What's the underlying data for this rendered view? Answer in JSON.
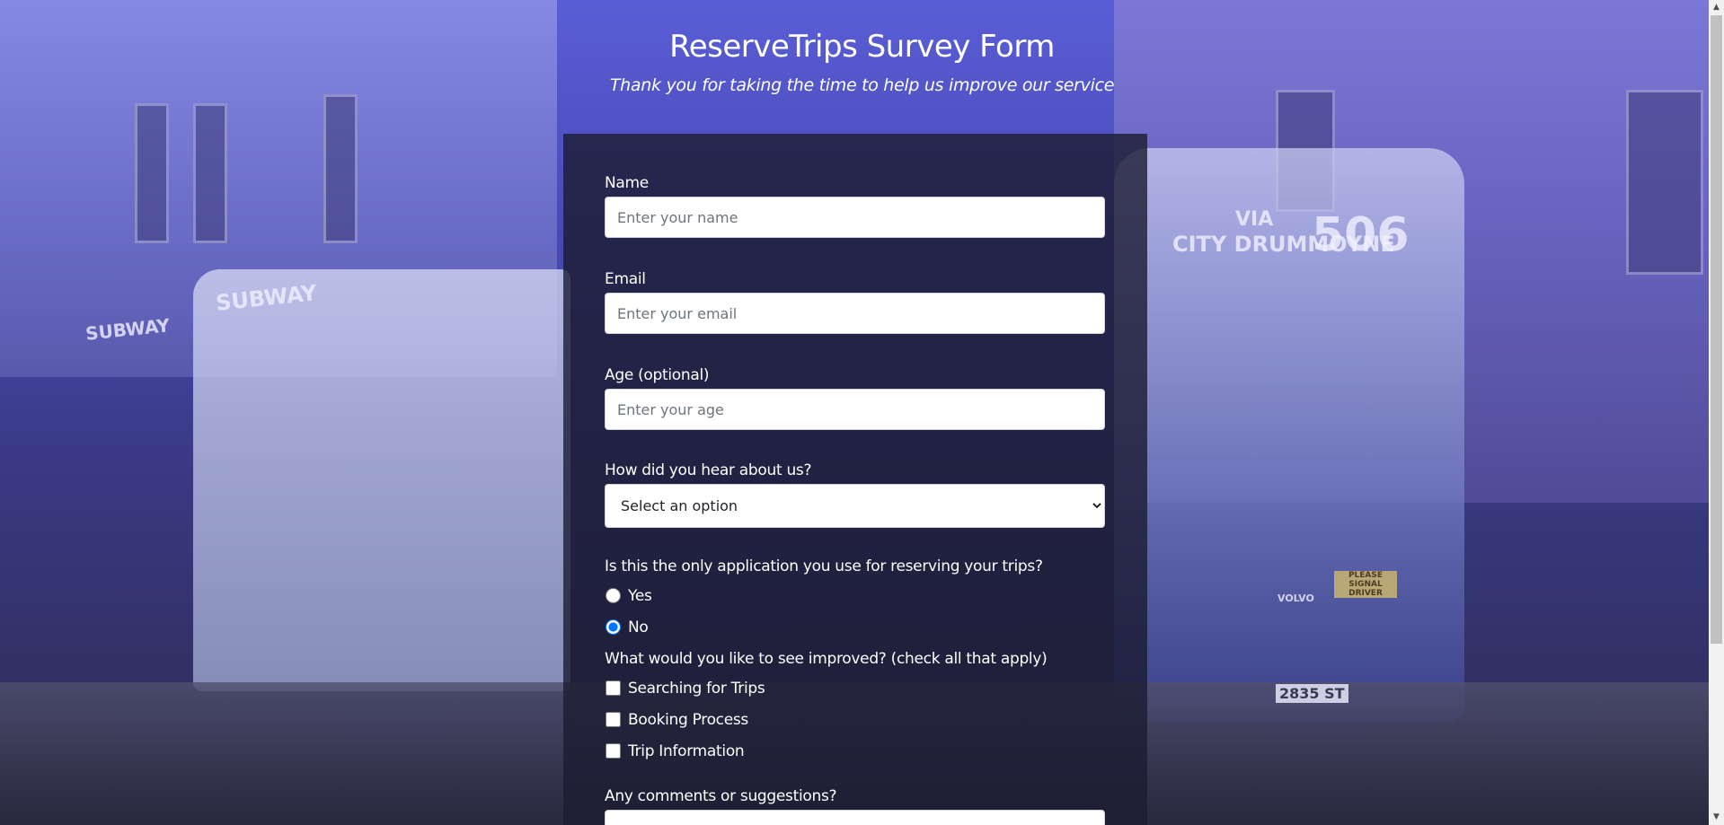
{
  "header": {
    "title": "ReserveTrips Survey Form",
    "subtitle": "Thank you for taking the time to help us improve our service"
  },
  "form": {
    "name": {
      "label": "Name",
      "placeholder": "Enter your name",
      "value": ""
    },
    "email": {
      "label": "Email",
      "placeholder": "Enter your email",
      "value": ""
    },
    "age": {
      "label": "Age (optional)",
      "placeholder": "Enter your age",
      "value": ""
    },
    "source": {
      "label": "How did you hear about us?",
      "selected": "Select an option"
    },
    "only_app": {
      "label": "Is this the only application you use for reserving your trips?",
      "options": [
        {
          "label": "Yes",
          "checked": false
        },
        {
          "label": "No",
          "checked": true
        }
      ]
    },
    "improve": {
      "label": "What would you like to see improved? (check all that apply)",
      "options": [
        {
          "label": "Searching for Trips",
          "checked": false
        },
        {
          "label": "Booking Process",
          "checked": false
        },
        {
          "label": "Trip Information",
          "checked": false
        }
      ]
    },
    "comments": {
      "label": "Any comments or suggestions?"
    }
  },
  "background_signs": {
    "subway_1": "SUBWAY",
    "subway_2": "SUBWAY",
    "bus_dest_via": "VIA",
    "bus_dest_city": "CITY DRUMMOYNE",
    "bus_route": "506",
    "bus_plate": "2835 ST",
    "bus_volvo": "VOLVO",
    "bus_signal": "PLEASE SIGNAL DRIVER"
  },
  "colors": {
    "overlay_top": "#5a5ed6",
    "overlay_bottom": "#2c2a4e",
    "card": "#1b1b32",
    "text": "#ffffff",
    "radio_accent": "#0075ff"
  }
}
